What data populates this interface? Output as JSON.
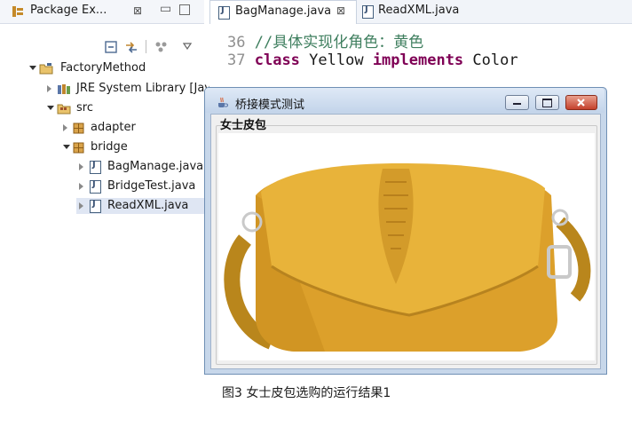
{
  "package_explorer": {
    "tab_title": "Package Ex...",
    "close_glyph": "⊠",
    "minimize_glyph": "▭",
    "tree": [
      {
        "label": "FactoryMethod",
        "icon": "project-icon",
        "state": "open"
      },
      {
        "label": "JRE System Library [Jav",
        "icon": "library-icon",
        "state": "closed"
      },
      {
        "label": "src",
        "icon": "source-folder-icon",
        "state": "open"
      },
      {
        "label": "adapter",
        "icon": "package-icon",
        "state": "closed"
      },
      {
        "label": "bridge",
        "icon": "package-icon",
        "state": "open"
      },
      {
        "label": "BagManage.java",
        "icon": "java-file-icon",
        "state": "closed"
      },
      {
        "label": "BridgeTest.java",
        "icon": "java-file-icon",
        "state": "closed"
      },
      {
        "label": "ReadXML.java",
        "icon": "java-file-icon",
        "state": "closed"
      }
    ]
  },
  "editor": {
    "tabs": [
      {
        "label": "BagManage.java",
        "close": "⊠",
        "active": true
      },
      {
        "label": "ReadXML.java",
        "active": false
      }
    ],
    "lines": [
      {
        "num": "36",
        "comment": "//具体实现化角色：黄色"
      },
      {
        "num": "37",
        "kw1": "class",
        "name": " Yellow ",
        "kw2": "implements",
        "rest": " Color"
      }
    ]
  },
  "window": {
    "title": "桥接模式测试",
    "group_label": "女士皮包",
    "image": "yellow-handbag-photo"
  },
  "caption": "图3 女士皮包选购的运行结果1",
  "colors": {
    "bag": "#e1a52b",
    "keyword": "#7f0055",
    "comment": "#3f7f5f"
  }
}
